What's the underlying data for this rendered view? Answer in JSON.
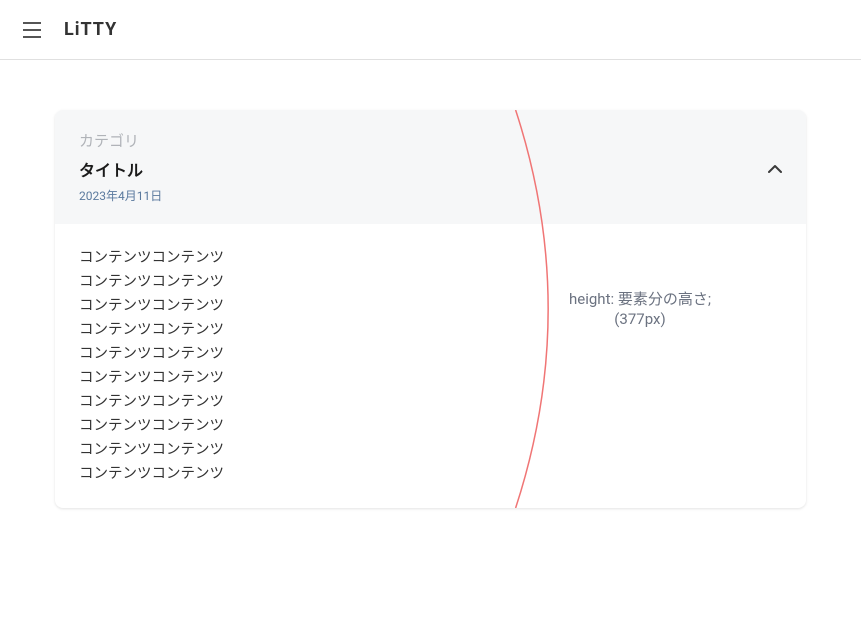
{
  "header": {
    "logo": "LiTTY"
  },
  "card": {
    "category": "カテゴリ",
    "title": "タイトル",
    "date": "2023年4月11日",
    "body_lines": [
      "コンテンツコンテンツ",
      "コンテンツコンテンツ",
      "コンテンツコンテンツ",
      "コンテンツコンテンツ",
      "コンテンツコンテンツ",
      "コンテンツコンテンツ",
      "コンテンツコンテンツ",
      "コンテンツコンテンツ",
      "コンテンツコンテンツ",
      "コンテンツコンテンツ"
    ]
  },
  "annotation": {
    "line1": "height: 要素分の高さ;",
    "line2": "(377px)"
  }
}
